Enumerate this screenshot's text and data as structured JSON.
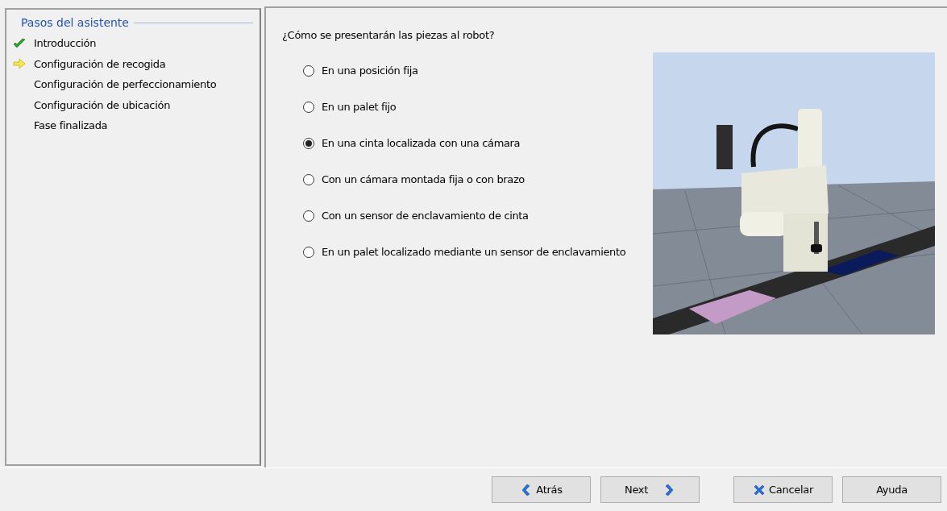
{
  "steps_panel": {
    "title": "Pasos del asistente",
    "steps": [
      {
        "label": "Introducción",
        "kind": "done"
      },
      {
        "label": "Configuración de recogida",
        "kind": "current"
      },
      {
        "label": "Configuración de perfeccionamiento",
        "kind": "plain"
      },
      {
        "label": "Configuración de ubicación",
        "kind": "plain"
      },
      {
        "label": "Fase finalizada",
        "kind": "plain"
      }
    ]
  },
  "content": {
    "question": "¿Cómo se presentarán las piezas al robot?",
    "options": [
      {
        "label": "En una posición fija",
        "selected": false
      },
      {
        "label": "En un palet fijo",
        "selected": false
      },
      {
        "label": "En una cinta localizada con una cámara",
        "selected": true
      },
      {
        "label": "Con un cámara montada fija o con brazo",
        "selected": false
      },
      {
        "label": "Con un sensor de enclavamiento de cinta",
        "selected": false
      },
      {
        "label": "En un palet localizado mediante un sensor de enclavamiento",
        "selected": false
      }
    ]
  },
  "buttons": [
    {
      "label": "Atrás",
      "kind": "back"
    },
    {
      "label": "Next",
      "kind": "next"
    },
    {
      "label": "Cancelar",
      "kind": "cancel"
    },
    {
      "label": "Ayuda",
      "kind": "plain"
    }
  ]
}
